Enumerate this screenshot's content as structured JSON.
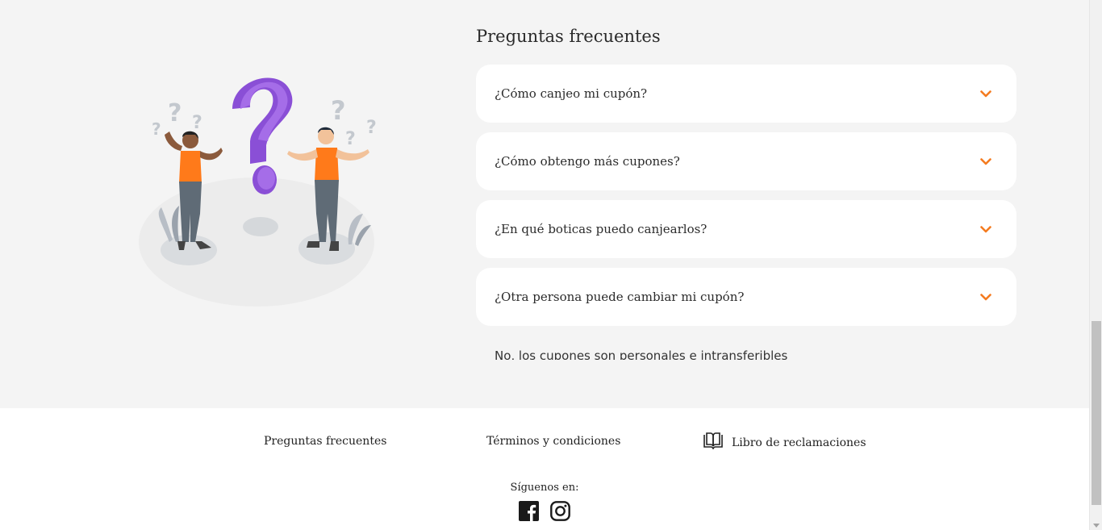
{
  "faq": {
    "title": "Preguntas frecuentes",
    "items": [
      {
        "question": "¿Cómo canjeo mi cupón?"
      },
      {
        "question": "¿Cómo obtengo más cupones?"
      },
      {
        "question": "¿En qué boticas puedo canjearlos?"
      },
      {
        "question": "¿Otra persona puede cambiar mi cupón?"
      }
    ],
    "open_answer": "No, los cupones son personales e intransferibles",
    "chevron_icon": "chevron-down-icon",
    "accent_color": "#f47b20"
  },
  "footer": {
    "links": {
      "faq": "Preguntas frecuentes",
      "terms": "Términos y condiciones",
      "complaints": "Libro de reclamaciones"
    },
    "follow_label": "Síguenos en:",
    "social": [
      "facebook-icon",
      "instagram-icon"
    ]
  },
  "colors": {
    "page_bg": "#f4f4f4",
    "card_bg": "#ffffff",
    "accent": "#f47b20",
    "purple": "#8a4fd6"
  }
}
